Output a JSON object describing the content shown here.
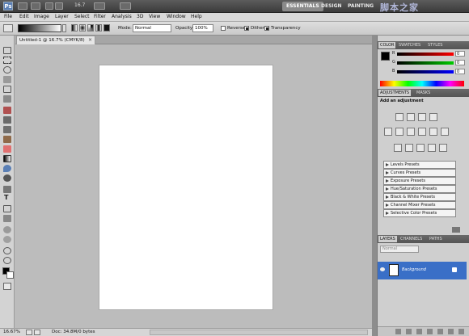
{
  "appbar": {
    "logo": "Ps",
    "zoom": "16.7",
    "workspaces": [
      "ESSENTIALS",
      "DESIGN",
      "PAINTING"
    ],
    "watermark": "脚本之家"
  },
  "menu": [
    "File",
    "Edit",
    "Image",
    "Layer",
    "Select",
    "Filter",
    "Analysis",
    "3D",
    "View",
    "Window",
    "Help"
  ],
  "options": {
    "mode_label": "Mode:",
    "mode_value": "Normal",
    "opacity_label": "Opacity:",
    "opacity_value": "100%",
    "reverse_label": "Reverse",
    "dither_label": "Dither",
    "transparency_label": "Transparency",
    "reverse_checked": false,
    "dither_checked": true,
    "transparency_checked": true
  },
  "document": {
    "tab_title": "Untitled-1 @ 16.7% (CMYK/8)"
  },
  "status": {
    "zoom": "16.67%",
    "doc_info": "Doc: 34.8M/0 bytes"
  },
  "color_panel": {
    "tabs": [
      "COLOR",
      "SWATCHES",
      "STYLES"
    ],
    "channels": [
      {
        "name": "R",
        "value": "0",
        "color": "#d42020"
      },
      {
        "name": "G",
        "value": "0",
        "color": "#22a022"
      },
      {
        "name": "B",
        "value": "0",
        "color": "#2040d0"
      }
    ]
  },
  "adjustments_panel": {
    "tabs": [
      "ADJUSTMENTS",
      "MASKS"
    ],
    "heading": "Add an adjustment",
    "presets": [
      "Levels Presets",
      "Curves Presets",
      "Exposure Presets",
      "Hue/Saturation Presets",
      "Black & White Presets",
      "Channel Mixer Presets",
      "Selective Color Presets"
    ]
  },
  "layers_panel": {
    "tabs": [
      "LAYERS",
      "CHANNELS",
      "PATHS"
    ],
    "blend_mode": "Normal",
    "layers": [
      {
        "name": "Background",
        "selected": true
      }
    ]
  },
  "colors": {
    "accent_selection": "#3a6fc7",
    "canvas_bg": "#bcbcbc"
  }
}
